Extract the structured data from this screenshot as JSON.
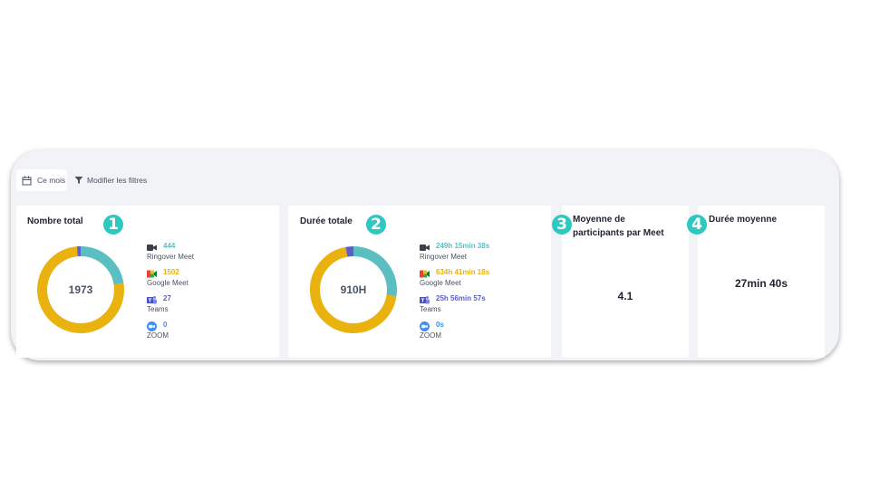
{
  "toolbar": {
    "period_label": "Ce mois",
    "filter_label": "Modifier les filtres"
  },
  "colors": {
    "ringover": "#5bbfc2",
    "google_meet": "#eab20e",
    "teams": "#5b5fc7",
    "zoom": "#3f8ef0",
    "badge": "#2fc8c0"
  },
  "cards": {
    "total": {
      "badge": "1",
      "title": "Nombre total",
      "center": "1973",
      "donut_fractions": [
        444,
        1502,
        27,
        0
      ],
      "legend": [
        {
          "value": "444",
          "name": "Ringover Meet",
          "icon": "video-camera-icon"
        },
        {
          "value": "1502",
          "name": "Google Meet",
          "icon": "google-meet-icon"
        },
        {
          "value": "27",
          "name": "Teams",
          "icon": "teams-icon"
        },
        {
          "value": "0",
          "name": "ZOOM",
          "icon": "zoom-icon"
        }
      ]
    },
    "duration": {
      "badge": "2",
      "title": "Durée totale",
      "center": "910H",
      "donut_fractions": [
        249.26,
        634.69,
        25.95,
        0
      ],
      "legend": [
        {
          "value": "249h 15min 38s",
          "name": "Ringover Meet",
          "icon": "video-camera-icon"
        },
        {
          "value": "634h 41min 18s",
          "name": "Google Meet",
          "icon": "google-meet-icon"
        },
        {
          "value": "25h 56min 57s",
          "name": "Teams",
          "icon": "teams-icon"
        },
        {
          "value": "0s",
          "name": "ZOOM",
          "icon": "zoom-icon"
        }
      ]
    },
    "participants": {
      "badge": "3",
      "title_line1": "Moyenne de",
      "title_line2": "participants par Meet",
      "value": "4.1"
    },
    "avg_duration": {
      "badge": "4",
      "title": "Durée moyenne",
      "value": "27min 40s"
    }
  }
}
